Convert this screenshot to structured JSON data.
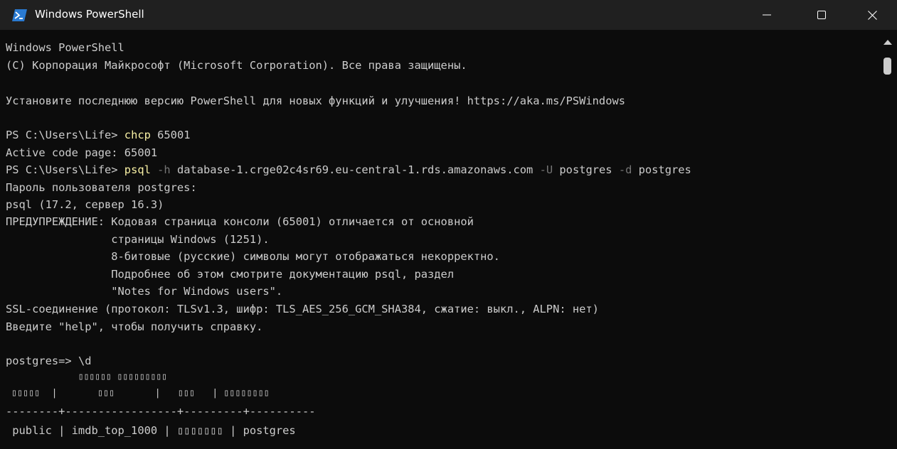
{
  "window": {
    "title": "Windows PowerShell",
    "icon": "powershell-icon",
    "controls": [
      "minimize-icon",
      "maximize-icon",
      "close-icon"
    ]
  },
  "colors": {
    "terminal_bg": "#0c0c0c",
    "titlebar_bg": "#202020",
    "text": "#cccccc",
    "command": "#f9f1a5",
    "parameter": "#767676"
  },
  "terminal": {
    "banner_1": "Windows PowerShell",
    "banner_2": "(C) Корпорация Майкрософт (Microsoft Corporation). Все права защищены.",
    "banner_3": "Установите последнюю версию PowerShell для новых функций и улучшения! https://aka.ms/PSWindows",
    "prompt_1": "PS C:\\Users\\Life> ",
    "cmd_1": "chcp",
    "cmd_1_args": " 65001",
    "output_1": "Active code page: 65001",
    "prompt_2": "PS C:\\Users\\Life> ",
    "cmd_2": "psql",
    "cmd_2_flag_h": " -h",
    "cmd_2_host": " database-1.crge02c4sr69.eu-central-1.rds.amazonaws.com",
    "cmd_2_flag_u": " -U",
    "cmd_2_user": " postgres",
    "cmd_2_flag_d": " -d",
    "cmd_2_db": " postgres",
    "password_prompt": "Пароль пользователя postgres:",
    "psql_version": "psql (17.2, сервер 16.3)",
    "warning_1": "ПРЕДУПРЕЖДЕНИЕ: Кодовая страница консоли (65001) отличается от основной",
    "warning_2": "                страницы Windows (1251).",
    "warning_3": "                8-битовые (русские) символы могут отображаться некорректно.",
    "warning_4": "                Подробнее об этом смотрите документацию psql, раздел",
    "warning_5": "                \"Notes for Windows users\".",
    "ssl": "SSL-соединение (протокол: TLSv1.3, шифр: TLS_AES_256_GCM_SHA384, сжатие: выкл., ALPN: нет)",
    "help": "Введите \"help\", чтобы получить справку.",
    "psql_prompt": "postgres=> ",
    "psql_cmd": "\\d",
    "table_title": "             ▯▯▯▯▯▯ ▯▯▯▯▯▯▯▯▯",
    "table_header": " ▯▯▯▯▯  |       ▯▯▯       |   ▯▯▯   | ▯▯▯▯▯▯▯▯",
    "table_separator": "--------+-----------------+---------+----------",
    "table_row": " public | imdb_top_1000 | ▯▯▯▯▯▯▯ | postgres"
  }
}
